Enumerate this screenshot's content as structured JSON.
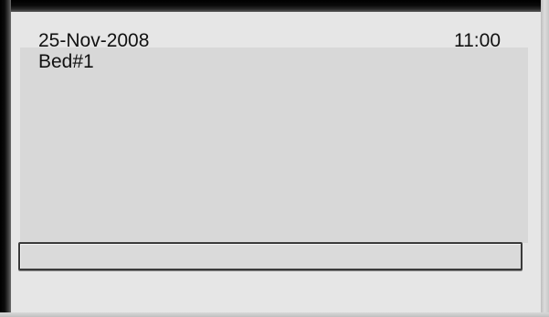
{
  "header": {
    "date": "25-Nov-2008",
    "time": "11:00",
    "bed": "Bed#1"
  },
  "status_bar": {
    "message": ""
  }
}
